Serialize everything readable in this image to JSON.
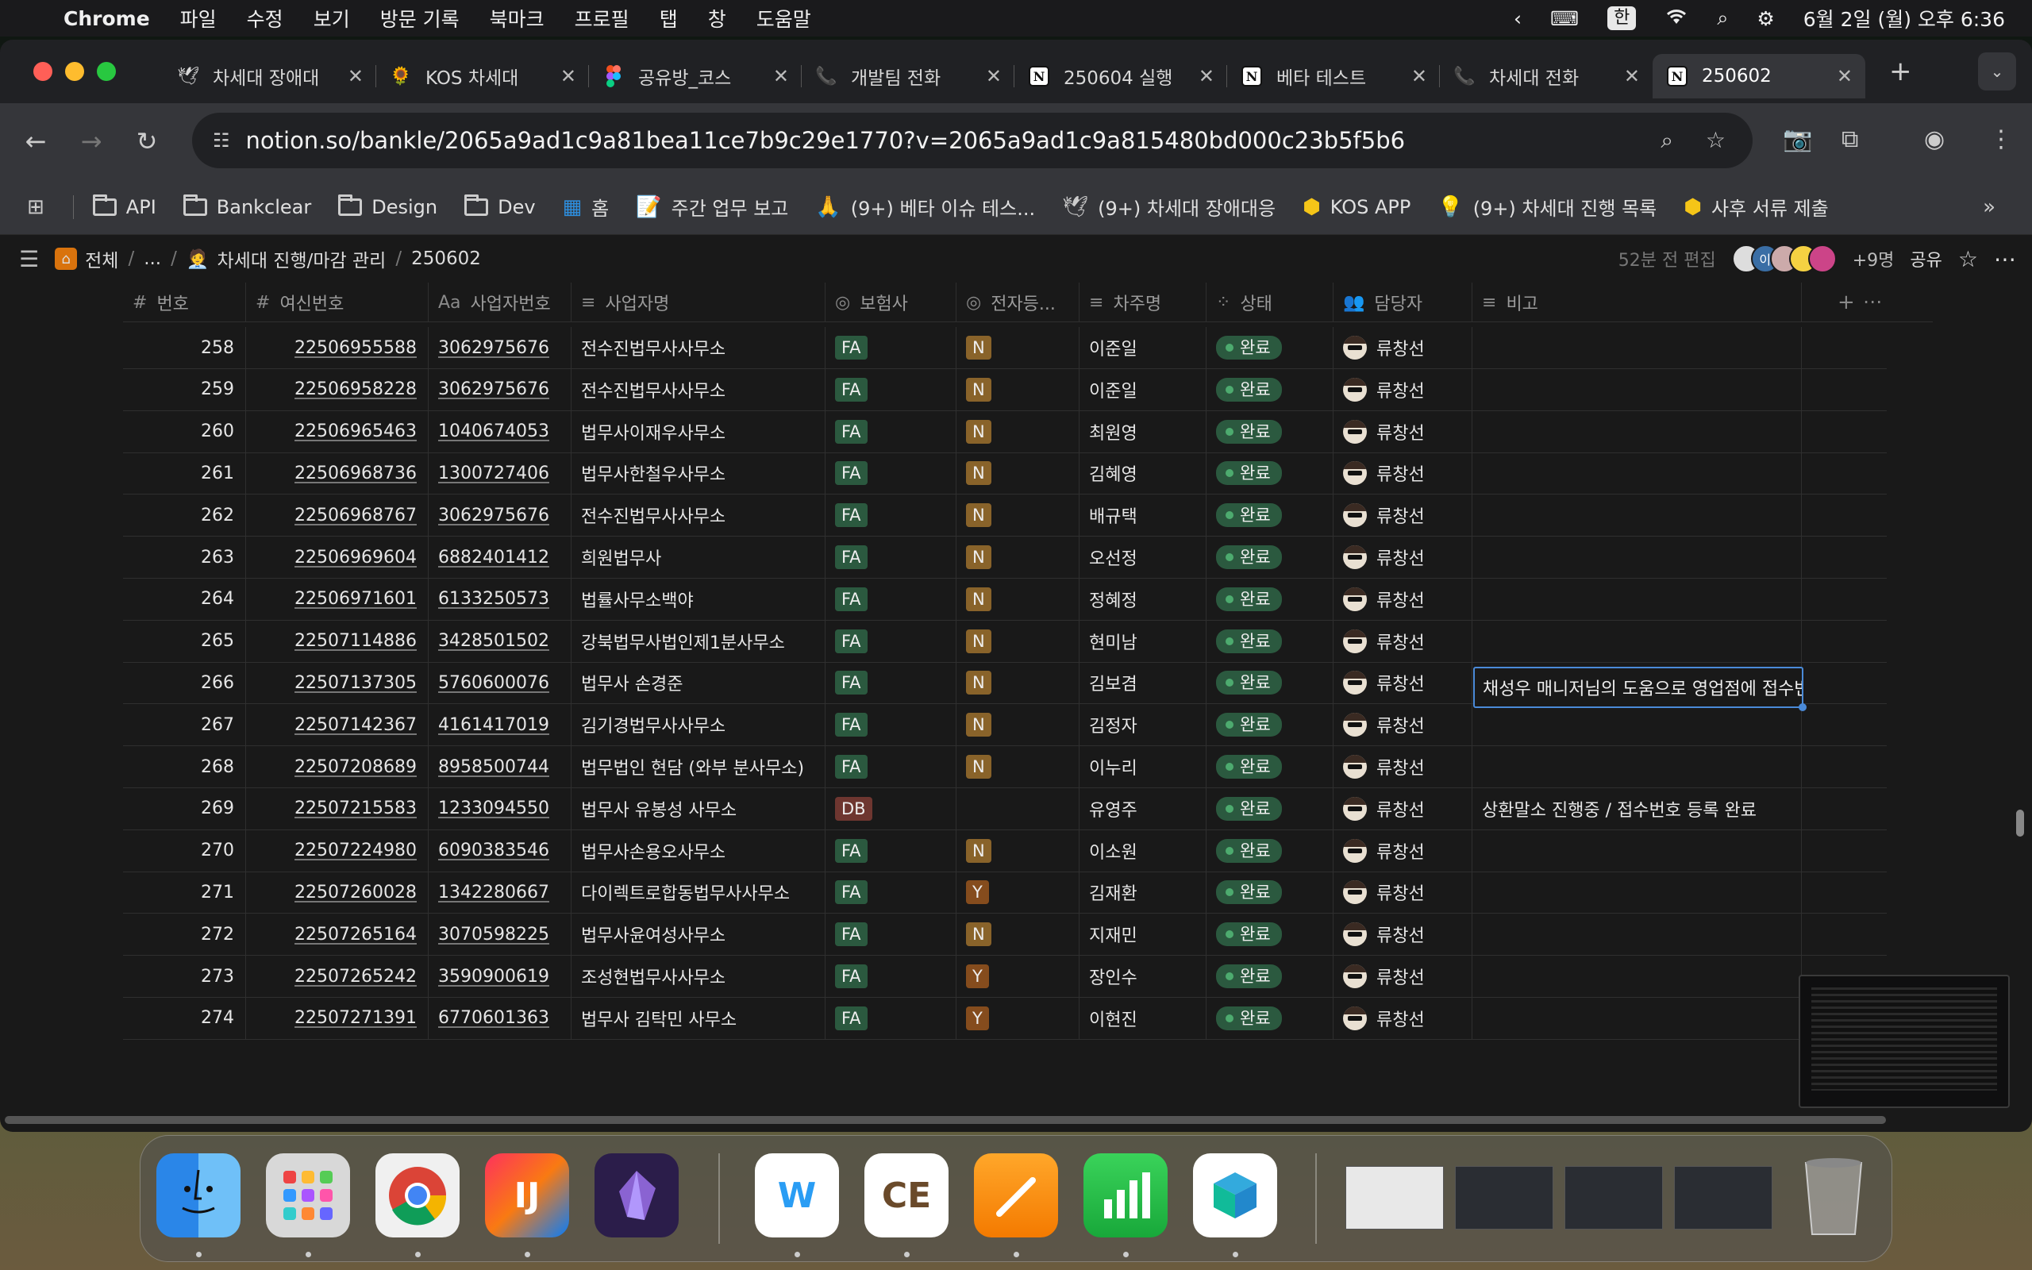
{
  "menubar": {
    "app": "Chrome",
    "items": [
      "파일",
      "수정",
      "보기",
      "방문 기록",
      "북마크",
      "프로필",
      "탭",
      "창",
      "도움말"
    ],
    "input_mode": "한",
    "datetime": "6월 2일 (월) 오후 6:36"
  },
  "tabs": [
    {
      "label": "차세대 장애대",
      "icon": "bird-icon"
    },
    {
      "label": "KOS 차세대",
      "icon": "sun-icon"
    },
    {
      "label": "공유방_코스",
      "icon": "figma-icon"
    },
    {
      "label": "개발팀 전화",
      "icon": "phone-icon"
    },
    {
      "label": "250604 실행",
      "icon": "notion-icon"
    },
    {
      "label": "베타 테스트",
      "icon": "notion-icon"
    },
    {
      "label": "차세대 전화",
      "icon": "phone-icon"
    },
    {
      "label": "250602",
      "icon": "notion-icon",
      "active": true
    }
  ],
  "url": "notion.so/bankle/2065a9ad1c9a81bea11ce7b9c29e1770?v=2065a9ad1c9a815480bd000c23b5f5b6",
  "bookmarks": [
    {
      "label": "API",
      "icon": "folder-icon"
    },
    {
      "label": "Bankclear",
      "icon": "folder-icon"
    },
    {
      "label": "Design",
      "icon": "folder-icon"
    },
    {
      "label": "Dev",
      "icon": "folder-icon"
    },
    {
      "label": "홈",
      "icon": "home-icon"
    },
    {
      "label": "주간 업무 보고",
      "icon": "memo-icon"
    },
    {
      "label": "(9+) 베타 이슈 테스...",
      "icon": "pray-icon"
    },
    {
      "label": "(9+) 차세대 장애대응",
      "icon": "bird-icon"
    },
    {
      "label": "KOS APP",
      "icon": "k-icon"
    },
    {
      "label": "(9+) 차세대 진행 목록",
      "icon": "bulb-icon"
    },
    {
      "label": "사후 서류 제출",
      "icon": "k-icon"
    }
  ],
  "notion": {
    "breadcrumb": [
      "전체",
      "...",
      "차세대 진행/마감 관리",
      "250602"
    ],
    "edited": "52분 전 편집",
    "avatar_initial": "이",
    "members": "+9명",
    "share": "공유"
  },
  "columns": [
    "번호",
    "여신번호",
    "사업자번호",
    "사업자명",
    "보험사",
    "전자등...",
    "차주명",
    "상태",
    "담당자",
    "비고"
  ],
  "column_icons": [
    "hash-icon",
    "hash-icon",
    "text-icon",
    "list-icon",
    "select-icon",
    "select-icon",
    "list-icon",
    "status-icon",
    "person-icon",
    "list-icon"
  ],
  "column_icon_glyphs": [
    "#",
    "#",
    "Aa",
    "≡",
    "◎",
    "◎",
    "≡",
    "⁘",
    "👥",
    "≡"
  ],
  "rows": [
    [
      "258",
      "22506955588",
      "3062975676",
      "전수진법무사사무소",
      "FA",
      "N",
      "이준일",
      "완료",
      "류창선",
      ""
    ],
    [
      "259",
      "22506958228",
      "3062975676",
      "전수진법무사사무소",
      "FA",
      "N",
      "이준일",
      "완료",
      "류창선",
      "채성우 매니저님의 도움으로 영업점에 접수번호"
    ],
    [
      "260",
      "22506965463",
      "1040674053",
      "법무사이재우사무소",
      "FA",
      "N",
      "최원영",
      "완료",
      "류창선",
      ""
    ],
    [
      "261",
      "22506968736",
      "1300727406",
      "법무사한철우사무소",
      "FA",
      "N",
      "김혜영",
      "완료",
      "류창선",
      ""
    ],
    [
      "262",
      "22506968767",
      "3062975676",
      "전수진법무사사무소",
      "FA",
      "N",
      "배규택",
      "완료",
      "류창선",
      ""
    ],
    [
      "263",
      "22506969604",
      "6882401412",
      "희원법무사",
      "FA",
      "N",
      "오선정",
      "완료",
      "류창선",
      ""
    ],
    [
      "264",
      "22506971601",
      "6133250573",
      "법률사무소백야",
      "FA",
      "N",
      "정혜정",
      "완료",
      "류창선",
      ""
    ],
    [
      "265",
      "22507114886",
      "3428501502",
      "강북법무사법인제1분사무소",
      "FA",
      "N",
      "현미남",
      "완료",
      "류창선",
      ""
    ],
    [
      "266",
      "22507137305",
      "5760600076",
      "법무사 손경준",
      "FA",
      "N",
      "김보겸",
      "완료",
      "류창선",
      ""
    ],
    [
      "267",
      "22507142367",
      "4161417019",
      "김기경법무사사무소",
      "FA",
      "N",
      "김정자",
      "완료",
      "류창선",
      ""
    ],
    [
      "268",
      "22507208689",
      "8958500744",
      "법무법인 현담 (와부 분사무소)",
      "FA",
      "N",
      "이누리",
      "완료",
      "류창선",
      ""
    ],
    [
      "269",
      "22507215583",
      "1233094550",
      "법무사 유봉성 사무소",
      "DB",
      "",
      "유영주",
      "완료",
      "류창선",
      "상환말소 진행중 / 접수번호 등록 완료"
    ],
    [
      "270",
      "22507224980",
      "6090383546",
      "법무사손용오사무소",
      "FA",
      "N",
      "이소원",
      "완료",
      "류창선",
      ""
    ],
    [
      "271",
      "22507260028",
      "1342280667",
      "다이렉트로합동법무사사무소",
      "FA",
      "Y",
      "김재환",
      "완료",
      "류창선",
      ""
    ],
    [
      "272",
      "22507265164",
      "3070598225",
      "법무사윤여성사무소",
      "FA",
      "N",
      "지재민",
      "완료",
      "류창선",
      ""
    ],
    [
      "273",
      "22507265242",
      "3590900619",
      "조성현법무사사무소",
      "FA",
      "Y",
      "장인수",
      "완료",
      "류창선",
      ""
    ],
    [
      "274",
      "22507271391",
      "6770601363",
      "법무사 김탁민 사무소",
      "FA",
      "Y",
      "이현진",
      "완료",
      "류창선",
      ""
    ]
  ],
  "dock": [
    {
      "name": "finder-icon"
    },
    {
      "name": "launchpad-icon"
    },
    {
      "name": "chrome-icon"
    },
    {
      "name": "intellij-icon",
      "glyph": "IJ"
    },
    {
      "name": "obsidian-icon"
    },
    {
      "name": "naver-whale-icon",
      "glyph": "W"
    },
    {
      "name": "dbeaver-icon",
      "glyph": "CE"
    },
    {
      "name": "pages-icon"
    },
    {
      "name": "numbers-icon"
    },
    {
      "name": "naver-box-icon"
    }
  ],
  "colors": {
    "fa_tag": "#2b593f",
    "db_tag": "#6e3630",
    "n_tag": "#89632a",
    "y_tag": "#854c1d",
    "status_done": "#2b593f",
    "selection": "#4a8ad8"
  }
}
